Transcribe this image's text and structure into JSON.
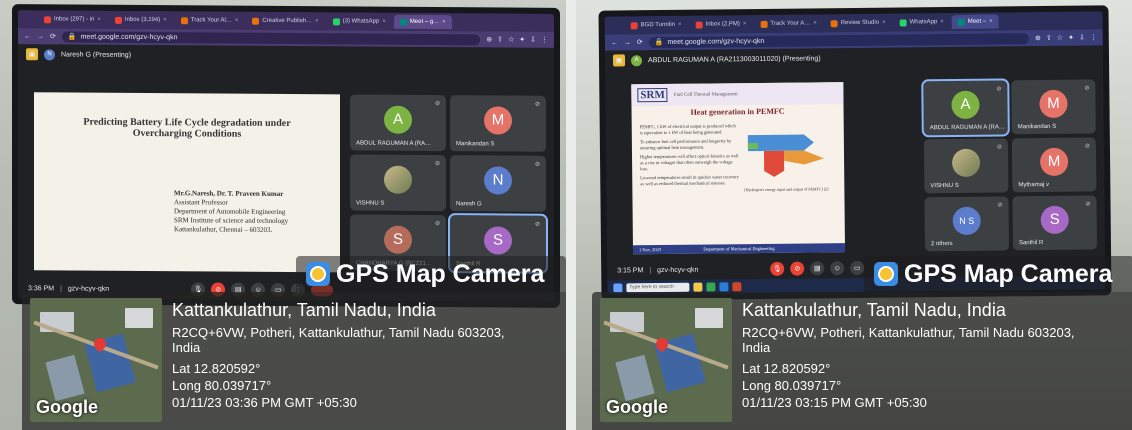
{
  "left": {
    "tabs": [
      {
        "label": "Inbox (297) - in",
        "color": "#ea4335",
        "active": false
      },
      {
        "label": "Inbox (3,194)",
        "color": "#ea4335",
        "active": false
      },
      {
        "label": "Track Your Al…",
        "color": "#e8710a",
        "active": false
      },
      {
        "label": "Creative Publish…",
        "color": "#e8710a",
        "active": false
      },
      {
        "label": "(3) WhatsApp",
        "color": "#25d366",
        "active": false
      },
      {
        "label": "Meet – g…",
        "color": "#00897b",
        "active": true
      }
    ],
    "url": "meet.google.com/gzv-hcyv-qkn",
    "presenter": "Naresh G (Presenting)",
    "presenter_initial": "N",
    "slide": {
      "title": "Predicting Battery Life Cycle degradation under Overcharging Conditions",
      "authors": "Mr.G.Naresh, Dr. T. Praveen Kumar",
      "lines": [
        "Assistant Professor",
        "Department of Automobile Engineering",
        "SRM Institute of science and technology",
        "Kattankulathur, Chennai – 603203."
      ]
    },
    "participants": [
      {
        "initial": "A",
        "name": "ABDUL RAGUMAN A (RA…",
        "color": "#7cb342"
      },
      {
        "initial": "M",
        "name": "Manikandan S",
        "color": "#e57368"
      },
      {
        "initial": "",
        "name": "VISHNU S",
        "color": "#8d8a74"
      },
      {
        "initial": "N",
        "name": "Naresh G",
        "color": "#5c7ccc"
      },
      {
        "initial": "S",
        "name": "CHANDHARYA G (RC221…",
        "color": "#b56c5a"
      },
      {
        "initial": "S",
        "name": "Santhil R",
        "color": "#a66ac6",
        "highlight": true
      }
    ],
    "time": "3:36 PM",
    "meeting_code": "gzv-hcyv-qkn",
    "gps_title": "GPS Map Camera",
    "location": "Kattankulathur, Tamil Nadu, India",
    "address": "R2CQ+6VW, Potheri, Kattankulathur, Tamil Nadu 603203,",
    "country": "India",
    "lat": "Lat 12.820592°",
    "long": "Long 80.039717°",
    "datetime": "01/11/23 03:36 PM GMT +05:30",
    "map_label": "Google"
  },
  "right": {
    "tabs": [
      {
        "label": "BGD Turnitin",
        "color": "#ea4335",
        "active": false
      },
      {
        "label": "Inbox (2,PM)",
        "color": "#ea4335",
        "active": false
      },
      {
        "label": "Track Your A…",
        "color": "#e8710a",
        "active": false
      },
      {
        "label": "Review Studio",
        "color": "#e8710a",
        "active": false
      },
      {
        "label": "WhatsApp",
        "color": "#25d366",
        "active": false
      },
      {
        "label": "Meet –",
        "color": "#00897b",
        "active": true
      }
    ],
    "url": "meet.google.com/gzv-hcyv-qkn",
    "presenter": "ABDUL RAGUMAN A (RA2113003011020) (Presenting)",
    "presenter_initial": "A",
    "slide": {
      "logo": "SRM",
      "kicker": "Fuel Cell Thermal Management",
      "title": "Heat generation in PEMFC",
      "bullets": [
        "PEMFC, 1 kW of electrical output is produced which is equivalent to 1 kW of heat being generated.",
        "To enhance fuel cell performance and longevity by ensuring optimal heat management.",
        "Higher temperatures will affect optical kinetics as well as a rise in voltages that often outweigh the voltage loss.",
        "Lowered temperatures result in quicker water recovery as well as reduced thermal mechanical stresses."
      ],
      "caption": "[Hydrogen's energy input and output of PEMFC] [2]",
      "footer": "Department of Mechanical Engineering",
      "date": "1 Nov, 2023"
    },
    "participants": [
      {
        "initial": "A",
        "name": "ABDUL RAGUMAN A (RA…",
        "color": "#7cb342",
        "highlight": true
      },
      {
        "initial": "M",
        "name": "Manikandan S",
        "color": "#e57368"
      },
      {
        "initial": "",
        "name": "VISHNU S",
        "color": "#8d8a74"
      },
      {
        "initial": "M",
        "name": "Mythamaj v",
        "color": "#e57368"
      },
      {
        "initial": "N S",
        "name": "2 others",
        "color": "#5c7ccc"
      },
      {
        "initial": "S",
        "name": "Santhil R",
        "color": "#a66ac6"
      }
    ],
    "time": "3:15 PM",
    "meeting_code": "gzv-hcyv-qkn",
    "search_placeholder": "Type here to search",
    "gps_title": "GPS Map Camera",
    "location": "Kattankulathur, Tamil Nadu, India",
    "address": "R2CQ+6VW, Potheri, Kattankulathur, Tamil Nadu 603203,",
    "country": "India",
    "lat": "Lat 12.820592°",
    "long": "Long 80.039717°",
    "datetime": "01/11/23 03:15 PM GMT +05:30",
    "map_label": "Google"
  }
}
